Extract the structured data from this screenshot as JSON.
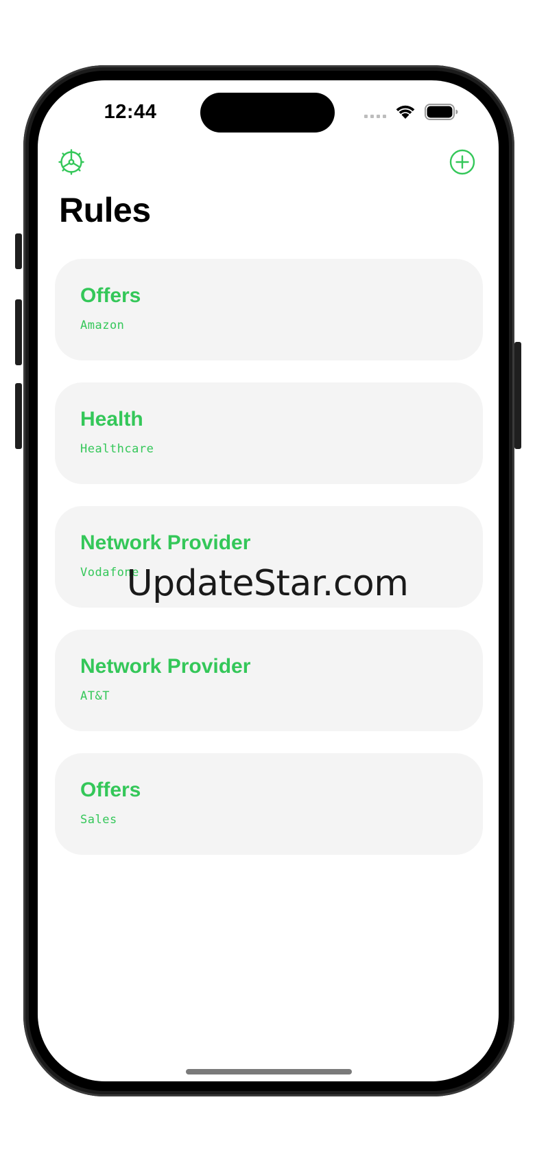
{
  "status_bar": {
    "time": "12:44"
  },
  "nav": {
    "settings_icon": "gear-icon",
    "add_icon": "plus-circle-icon"
  },
  "page": {
    "title": "Rules"
  },
  "rules": [
    {
      "title": "Offers",
      "subtitle": "Amazon"
    },
    {
      "title": "Health",
      "subtitle": "Healthcare"
    },
    {
      "title": "Network Provider",
      "subtitle": "Vodafone"
    },
    {
      "title": "Network Provider",
      "subtitle": "AT&T"
    },
    {
      "title": "Offers",
      "subtitle": "Sales"
    }
  ],
  "watermark": "UpdateStar.com",
  "colors": {
    "accent": "#34c759",
    "card_background": "#f4f4f4",
    "title": "#000000"
  }
}
